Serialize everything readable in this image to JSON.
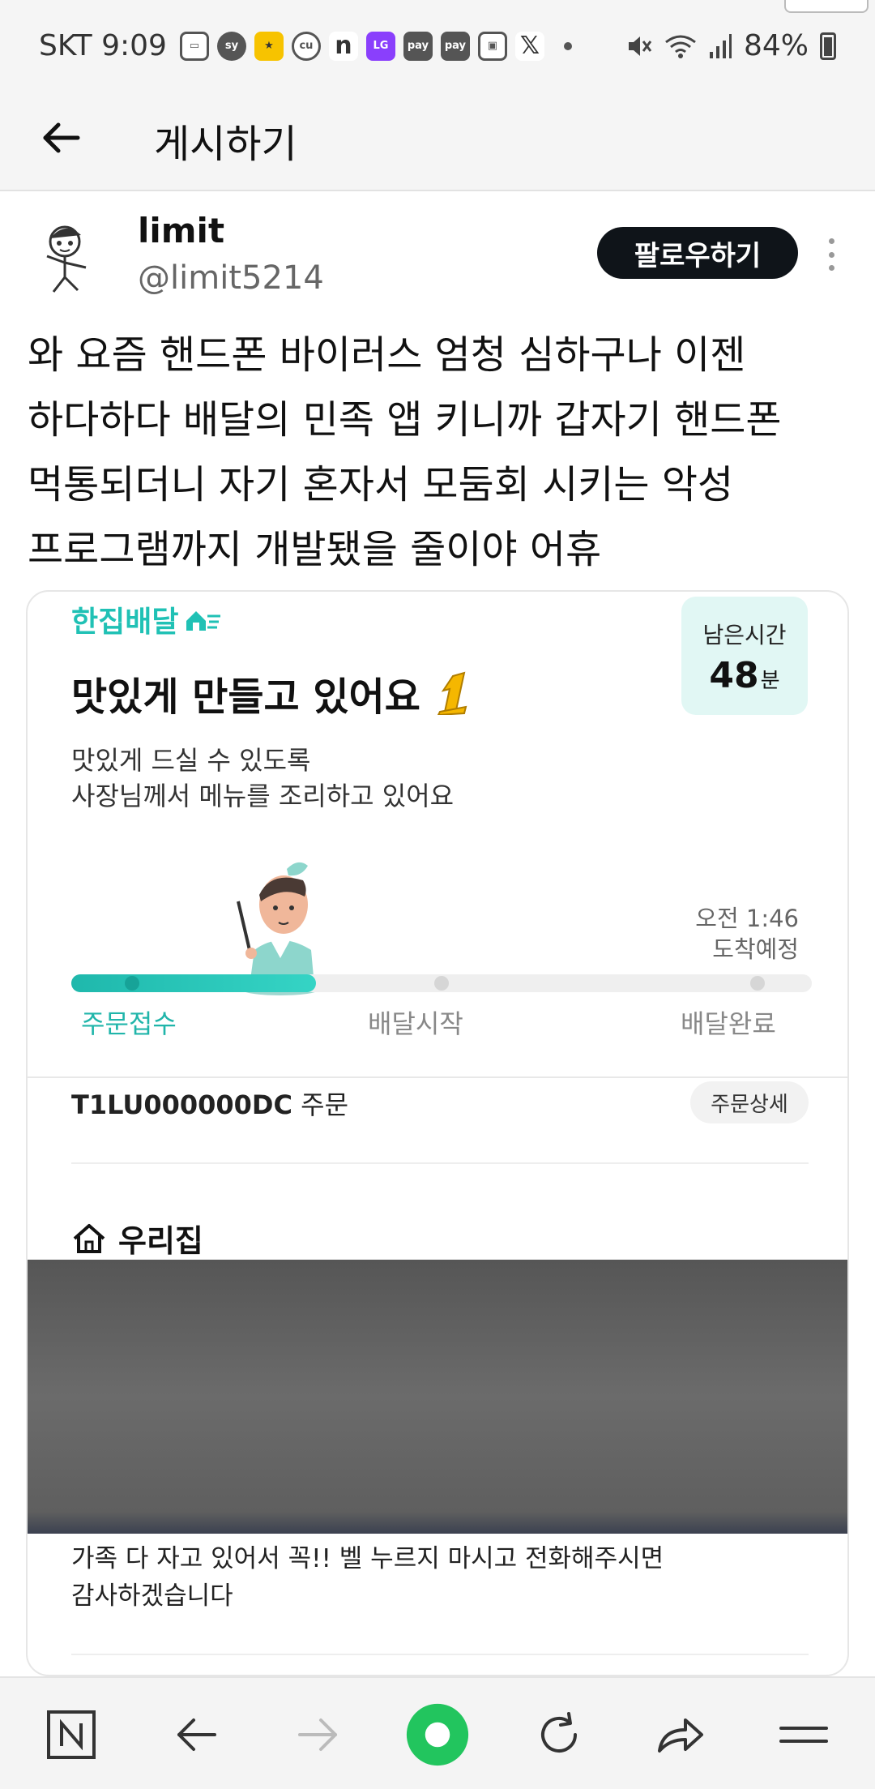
{
  "status_bar": {
    "carrier_time": "SKT 9:09",
    "notification_icons": [
      "carrier-app-icon",
      "sy-icon",
      "kb-icon",
      "cu-icon",
      "n-icon",
      "lg-icon",
      "pay-icon",
      "pay-icon",
      "wallet-icon",
      "x-icon"
    ],
    "battery": "84%"
  },
  "header": {
    "title": "게시하기"
  },
  "post": {
    "username": "limit",
    "handle": "@limit5214",
    "follow_label": "팔로우하기",
    "text_lines": [
      "와 요즘 핸드폰 바이러스 엄청 심하구나 이젠",
      "하다하다 배달의 민족 앱 키니까 갑자기 핸드폰",
      "먹통되더니 자기 혼자서 모둠회 시키는 악성",
      "프로그램까지 개발됐을 줄이야 어휴"
    ]
  },
  "embed": {
    "brand": "한집배달",
    "remaining": {
      "label": "남은시간",
      "value": "48",
      "unit": "분"
    },
    "status_heading": "맛있게 만들고 있어요",
    "status_desc": [
      "맛있게 드실 수 있도록",
      "사장님께서 메뉴를 조리하고 있어요"
    ],
    "eta": {
      "time": "오전 1:46",
      "label": "도착예정"
    },
    "progress": {
      "fraction": 0.33,
      "steps": [
        "주문접수",
        "배달시작",
        "배달완료"
      ],
      "accent": "#20b5aa"
    },
    "order_id": "T1LU000000DC",
    "order_suffix": "주문",
    "order_detail_label": "주문상세",
    "address_label": "우리집",
    "request_lines": [
      "가족 다 자고 있어서 꼭!! 벨 누르지 마시고 전화해주시면",
      "감사하겠습니다"
    ]
  },
  "colors": {
    "accent": "#20c1b5",
    "follow_bg": "#0f1419",
    "home_button": "#22c55e"
  }
}
